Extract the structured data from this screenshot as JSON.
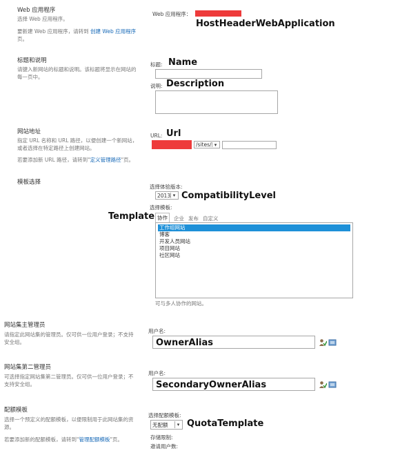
{
  "web_app": {
    "title": "Web 应用程序",
    "desc": "选择 Web 应用程序。",
    "note_prefix": "要新建 Web 应用程序，请转到",
    "note_link": "创建 Web 应用程序",
    "note_suffix": "页。",
    "field_label": "Web 应用程序：",
    "overlay": "HostHeaderWebApplication"
  },
  "title_desc": {
    "title": "标题和说明",
    "desc": "请键入新网站的标题和说明。该标题将显示在网站的每一页中。",
    "title_label": "标题:",
    "title_overlay": "Name",
    "title_value": "",
    "desc_label": "说明:",
    "desc_overlay": "Description",
    "desc_value": ""
  },
  "site_address": {
    "title": "网站地址",
    "desc": "指定 URL 名称和 URL 路径，以便创建一个新网站，或者选择在特定路径上创建网站。",
    "note_prefix": "若要添加新 URL 路径，请转到\"",
    "note_link": "定义管理路径",
    "note_suffix": "\"页。",
    "url_label": "URL:",
    "url_overlay": "Url",
    "path_value": "/sites/",
    "name_value": ""
  },
  "template": {
    "title": "模板选择",
    "version_label": "选择体验版本:",
    "version_value": "2013",
    "version_overlay": "CompatibilityLevel",
    "select_label": "选择模板:",
    "left_overlay": "Template",
    "tabs": [
      "协作",
      "企业",
      "发布",
      "自定义"
    ],
    "items": [
      "工作组网站",
      "博客",
      "开发人员网站",
      "项目网站",
      "社区网站"
    ],
    "selected_index": 0,
    "caption": "可与多人协作的网站。"
  },
  "primary_admin": {
    "title": "网站集主管理员",
    "desc": "请指定此网站集的管理员。仅可供一位用户登录；不支持安全组。",
    "user_label": "用户名:",
    "value": "OwnerAlias"
  },
  "secondary_admin": {
    "title": "网站集第二管理员",
    "desc": "可选择指定网站集第二管理员。仅可供一位用户登录；不支持安全组。",
    "user_label": "用户名:",
    "value": "SecondaryOwnerAlias"
  },
  "quota": {
    "title": "配额模板",
    "desc": "选择一个预定义的配额模板，以便限制用于此网站集的资源。",
    "note_prefix": "若要添加新的配额模板，请转到\"",
    "note_link": "管理配额模板",
    "note_suffix": "\"页。",
    "select_label": "选择配额模板:",
    "select_value": "无配额",
    "overlay": "QuotaTemplate",
    "storage_label": "存储限制:",
    "invite_label": "邀请用户数:"
  },
  "colors": {
    "redact": "#ee3b3b",
    "link": "#1a6bb8",
    "selected": "#1e90d8"
  }
}
